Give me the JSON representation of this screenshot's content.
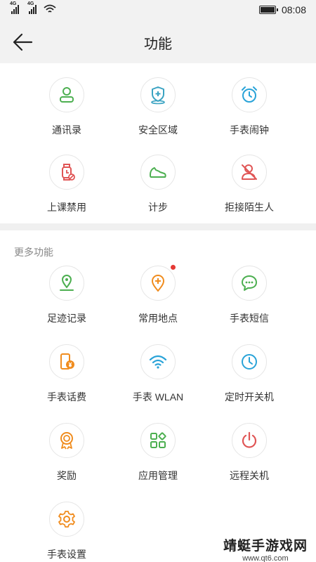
{
  "status_bar": {
    "network_1": "4G",
    "network_2": "4G",
    "time": "08:08",
    "battery_level": 1.0
  },
  "header": {
    "title": "功能"
  },
  "main_functions": [
    {
      "label": "通讯录",
      "icon": "contacts-icon",
      "color": "#4caf50"
    },
    {
      "label": "安全区域",
      "icon": "safe-zone-icon",
      "color": "#3aa3c2"
    },
    {
      "label": "手表闹钟",
      "icon": "alarm-icon",
      "color": "#29a3d8"
    },
    {
      "label": "上课禁用",
      "icon": "class-mode-icon",
      "color": "#e05555"
    },
    {
      "label": "计步",
      "icon": "step-icon",
      "color": "#4caf50"
    },
    {
      "label": "拒接陌生人",
      "icon": "block-stranger-icon",
      "color": "#e05555"
    }
  ],
  "more_section": {
    "title": "更多功能"
  },
  "more_functions": [
    {
      "label": "足迹记录",
      "icon": "footprint-icon",
      "color": "#4caf50",
      "badge": false
    },
    {
      "label": "常用地点",
      "icon": "favorite-place-icon",
      "color": "#f08c1e",
      "badge": true
    },
    {
      "label": "手表短信",
      "icon": "sms-icon",
      "color": "#4caf50",
      "badge": false
    },
    {
      "label": "手表话费",
      "icon": "phone-bill-icon",
      "color": "#f08c1e",
      "badge": false
    },
    {
      "label": "手表 WLAN",
      "icon": "wifi-icon",
      "color": "#29a3d8",
      "badge": false
    },
    {
      "label": "定时开关机",
      "icon": "timer-icon",
      "color": "#29a3d8",
      "badge": false
    },
    {
      "label": "奖励",
      "icon": "reward-icon",
      "color": "#f08c1e",
      "badge": false
    },
    {
      "label": "应用管理",
      "icon": "app-manage-icon",
      "color": "#4caf50",
      "badge": false
    },
    {
      "label": "远程关机",
      "icon": "power-icon",
      "color": "#e05555",
      "badge": false
    },
    {
      "label": "手表设置",
      "icon": "settings-icon",
      "color": "#f08c1e",
      "badge": false
    }
  ],
  "watermark": {
    "main": "靖蜓手游戏网",
    "sub": "www.qt6.com"
  }
}
